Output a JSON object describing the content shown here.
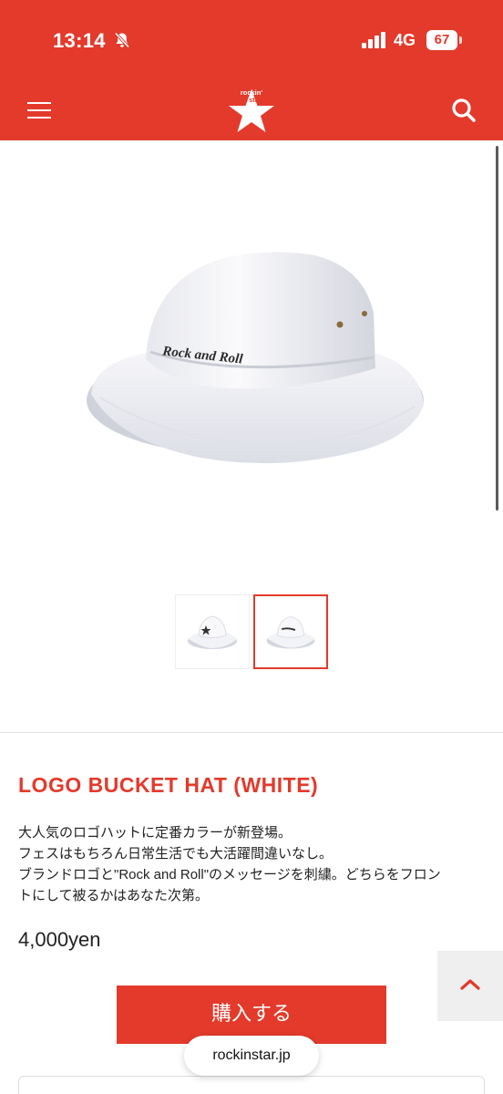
{
  "status_bar": {
    "time": "13:14",
    "network": "4G",
    "battery": "67"
  },
  "header": {
    "logo_text_top": "rockin'",
    "logo_text_bottom": "star",
    "brand_color": "#e33a2b"
  },
  "gallery": {
    "embroidery_text": "Rock and Roll",
    "thumb_count": 2,
    "selected_thumb": 2
  },
  "product": {
    "title": "LOGO BUCKET HAT (WHITE)",
    "description": [
      "大人気のロゴハットに定番カラーが新登場。",
      "フェスはもちろん日常生活でも大活躍間違いなし。",
      "ブランドロゴと\"Rock and Roll\"のメッセージを刺繍。どちらをフロン",
      "トにして被るかはあなた次第。"
    ],
    "price": "4,000yen",
    "buy_label": "購入する"
  },
  "scroll_top_icon": "︿",
  "browser": {
    "url": "rockinstar.jp"
  },
  "icons": {
    "menu": "hamburger-menu-icon",
    "search": "search-icon",
    "bell": "bell-slash-icon",
    "signal": "signal-icon"
  }
}
